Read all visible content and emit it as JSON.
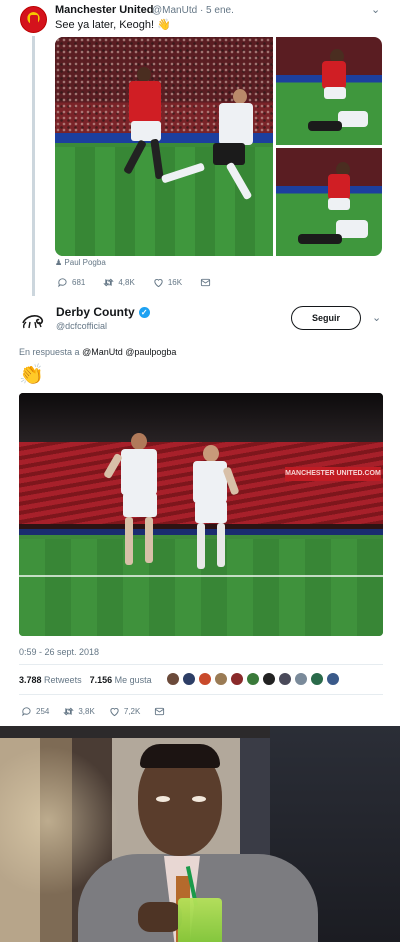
{
  "quoted_tweet": {
    "author_name": "Manchester United",
    "handle_date": "@ManUtd · 5 ene.",
    "text": "See ya later, Keogh! 👋",
    "photo_credit": "Paul Pogba",
    "actions": {
      "replies": "681",
      "retweets": "4,8K",
      "likes": "16K"
    }
  },
  "reply_tweet": {
    "author_name": "Derby County",
    "handle": "@dcfcofficial",
    "follow_label": "Seguir",
    "reply_prefix": "En respuesta a",
    "reply_mentions": "@ManUtd @paulpogba",
    "text": "👏",
    "media_sign_text": "MANCHESTER UNITED.COM",
    "timestamp": "0:59 - 26 sept. 2018",
    "retweets_count": "3.788",
    "retweets_label": "Retweets",
    "likes_count": "7.156",
    "likes_label": "Me gusta",
    "actions": {
      "replies": "254",
      "retweets": "3,8K",
      "likes": "7,2K"
    },
    "liker_colors": [
      "#6b4a3a",
      "#2d3e66",
      "#c94a2b",
      "#9a7b54",
      "#8a2a2a",
      "#3a7a3a",
      "#222222",
      "#4a4a5a",
      "#7a8a9a",
      "#2a6a4a",
      "#3a5a8a"
    ]
  },
  "colors": {
    "link_blue": "#1da1f2",
    "muted_text": "#657786",
    "man_utd_red": "#d4121c"
  }
}
